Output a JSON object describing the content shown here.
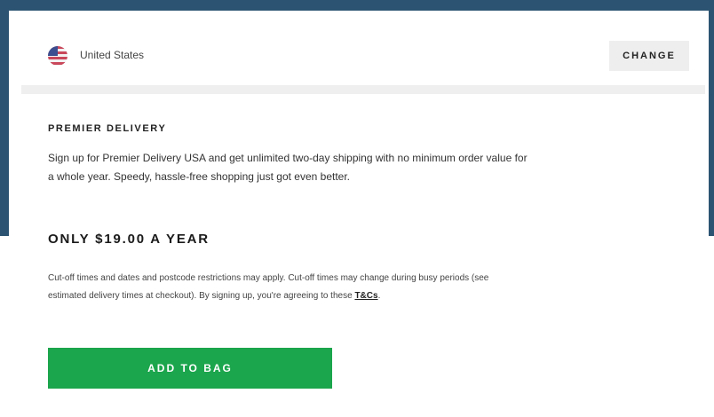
{
  "country": {
    "name": "United States",
    "change_label": "CHANGE"
  },
  "delivery": {
    "title": "PREMIER DELIVERY",
    "description": "Sign up for Premier Delivery USA and get unlimited two-day shipping with no minimum order value for a whole year. Speedy, hassle-free shopping just got even better.",
    "price": "ONLY $19.00 A YEAR",
    "terms_text": "Cut-off times and dates and postcode restrictions may apply. Cut-off times may change during busy periods (see estimated delivery times at checkout). By signing up, you're agreeing to these ",
    "terms_link": "T&Cs",
    "terms_end": ".",
    "add_label": "ADD TO BAG"
  },
  "colors": {
    "background": "#2c5472",
    "accent_green": "#1ba54c",
    "divider": "#efefef"
  },
  "icons": {
    "flag": "us-flag-icon"
  }
}
